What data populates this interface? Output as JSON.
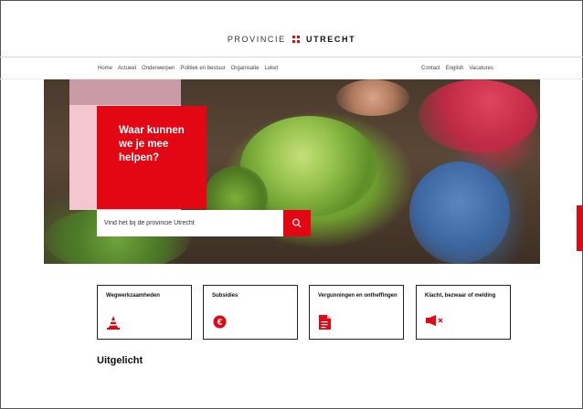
{
  "header": {
    "logo_left": "PROVINCIE",
    "logo_right": "UTRECHT"
  },
  "nav": {
    "primary": [
      "Home",
      "Actueel",
      "Onderwerpen",
      "Politiek en bestuur",
      "Organisatie",
      "Loket"
    ],
    "secondary": [
      "Contact",
      "English",
      "Vacatures"
    ]
  },
  "hero": {
    "headline": "Waar kunnen we je mee helpen?",
    "search_placeholder": "Vind het bij de provincie Utrecht",
    "search_icon": "search-icon"
  },
  "tiles": [
    {
      "label": "Wegwerkzaamheden",
      "icon": "traffic-cone-icon"
    },
    {
      "label": "Subsidies",
      "icon": "euro-icon"
    },
    {
      "label": "Vergunningen en ontheffingen",
      "icon": "document-icon"
    },
    {
      "label": "Klacht, bezwaar of melding",
      "icon": "megaphone-icon"
    }
  ],
  "featured": {
    "title": "Uitgelicht"
  },
  "colors": {
    "accent": "#e30613",
    "pink": "#f4c6d0"
  }
}
